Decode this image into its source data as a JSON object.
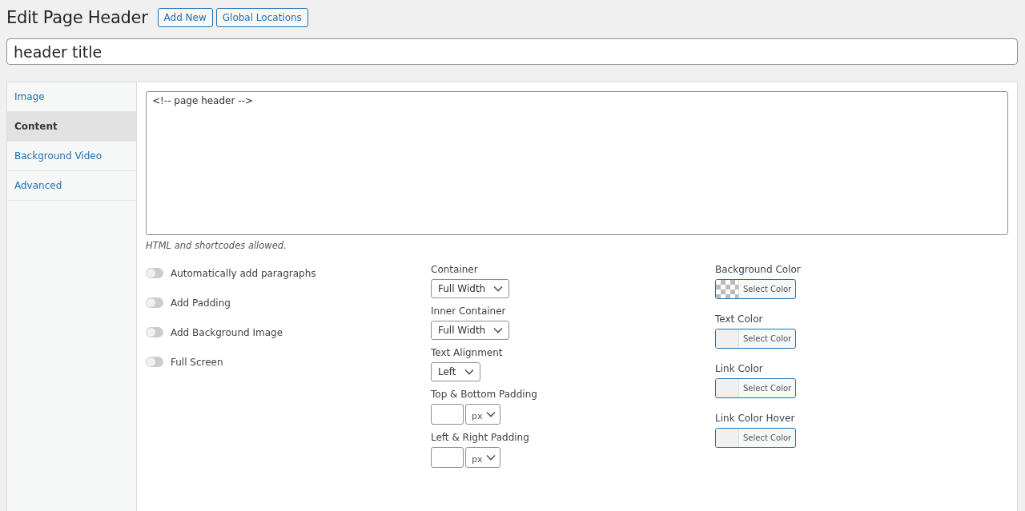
{
  "page": {
    "title": "Edit Page Header",
    "actions": [
      "Add New",
      "Global Locations"
    ]
  },
  "title_field": {
    "value": "header title"
  },
  "tabs": [
    {
      "label": "Image",
      "selected": false
    },
    {
      "label": "Content",
      "selected": true
    },
    {
      "label": "Background Video",
      "selected": false
    },
    {
      "label": "Advanced",
      "selected": false
    }
  ],
  "editor": {
    "value": "<!-- page header -->",
    "hint": "HTML and shortcodes allowed."
  },
  "toggles": [
    {
      "label": "Automatically add paragraphs",
      "on": false
    },
    {
      "label": "Add Padding",
      "on": false
    },
    {
      "label": "Add Background Image",
      "on": false
    },
    {
      "label": "Full Screen",
      "on": false
    }
  ],
  "settings": [
    {
      "kind": "select",
      "label": "Container",
      "value": "Full Width"
    },
    {
      "kind": "select",
      "label": "Inner Container",
      "value": "Full Width"
    },
    {
      "kind": "select",
      "label": "Text Alignment",
      "value": "Left"
    },
    {
      "kind": "padding",
      "label": "Top & Bottom Padding",
      "unit": "px"
    },
    {
      "kind": "padding",
      "label": "Left & Right Padding",
      "unit": "px"
    }
  ],
  "colors": [
    {
      "label": "Background Color",
      "button": "Select Color",
      "kind": "transparent"
    },
    {
      "label": "Text Color",
      "button": "Select Color",
      "kind": "unset"
    },
    {
      "label": "Link Color",
      "button": "Select Color",
      "kind": "unset"
    },
    {
      "label": "Link Color Hover",
      "button": "Select Color",
      "kind": "unset"
    }
  ]
}
